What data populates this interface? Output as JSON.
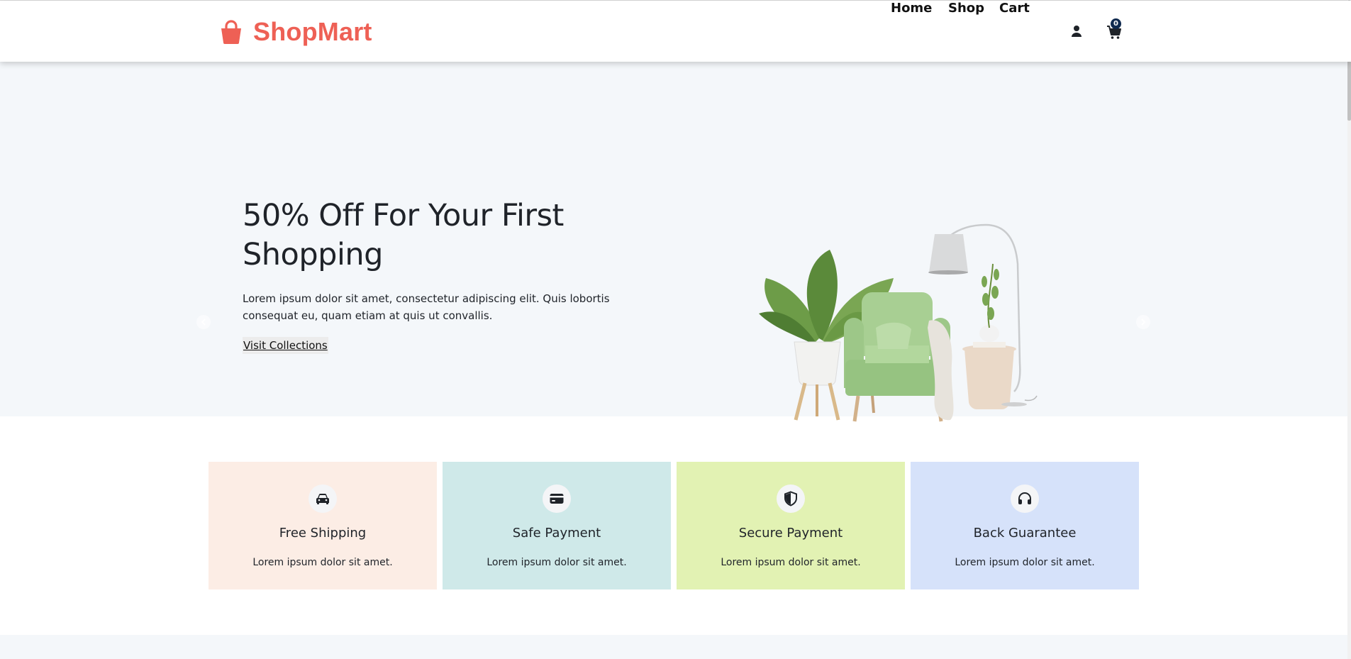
{
  "brand": {
    "name": "ShopMart",
    "color": "#ee6055"
  },
  "nav": {
    "links": [
      {
        "label": "Home"
      },
      {
        "label": "Shop"
      },
      {
        "label": "Cart"
      }
    ],
    "user_icon": "user-icon",
    "cart_icon": "cart-icon",
    "cart_count": "0"
  },
  "hero": {
    "title": "50% Off For Your First Shopping",
    "text": "Lorem ipsum dolor sit amet, consectetur adipiscing elit. Quis lobortis consequat eu, quam etiam at quis ut convallis.",
    "button_label": "Visit Collections",
    "background": "#f4f7fa"
  },
  "features": [
    {
      "title": "Free Shipping",
      "text": "Lorem ipsum dolor sit amet.",
      "icon": "car-icon",
      "color": "#fcede5"
    },
    {
      "title": "Safe Payment",
      "text": "Lorem ipsum dolor sit amet.",
      "icon": "credit-card-icon",
      "color": "#cfe9e9"
    },
    {
      "title": "Secure Payment",
      "text": "Lorem ipsum dolor sit amet.",
      "icon": "shield-icon",
      "color": "#e2f2b3"
    },
    {
      "title": "Back Guarantee",
      "text": "Lorem ipsum dolor sit amet.",
      "icon": "headphones-icon",
      "color": "#d6e2fa"
    }
  ]
}
